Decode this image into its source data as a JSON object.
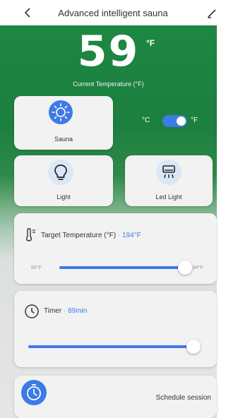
{
  "header": {
    "back_icon": "chevron-left-icon",
    "title": "Advanced intelligent sauna",
    "edit_icon": "pencil-icon"
  },
  "temperature": {
    "value": "59",
    "unit": "°F",
    "label": "Current Temperature (°F)"
  },
  "tiles": {
    "sauna": {
      "label": "Sauna",
      "icon": "sun-icon",
      "active": true
    },
    "light": {
      "label": "Light",
      "icon": "lightbulb-icon"
    },
    "led_light": {
      "label": "Led Light",
      "icon": "air-conditioner-icon"
    }
  },
  "unit_toggle": {
    "left": "°C",
    "right": "°F",
    "selected": "°F"
  },
  "target_temperature": {
    "label": "Target Temperature (°F)",
    "separator": "·",
    "value": "194°F",
    "min_label": "86°F",
    "max_label": "194°F",
    "level": 1.0,
    "icon": "thermometer-icon"
  },
  "timer": {
    "label": "Timer",
    "separator": "·",
    "value": "89min",
    "level": 1.0,
    "icon": "clock-icon"
  },
  "schedule": {
    "label": "Schedule session",
    "icon": "timer-icon"
  },
  "colors": {
    "accent": "#3d7be5",
    "header_green": "#1e8a43",
    "card_bg": "#f2f2f2"
  }
}
